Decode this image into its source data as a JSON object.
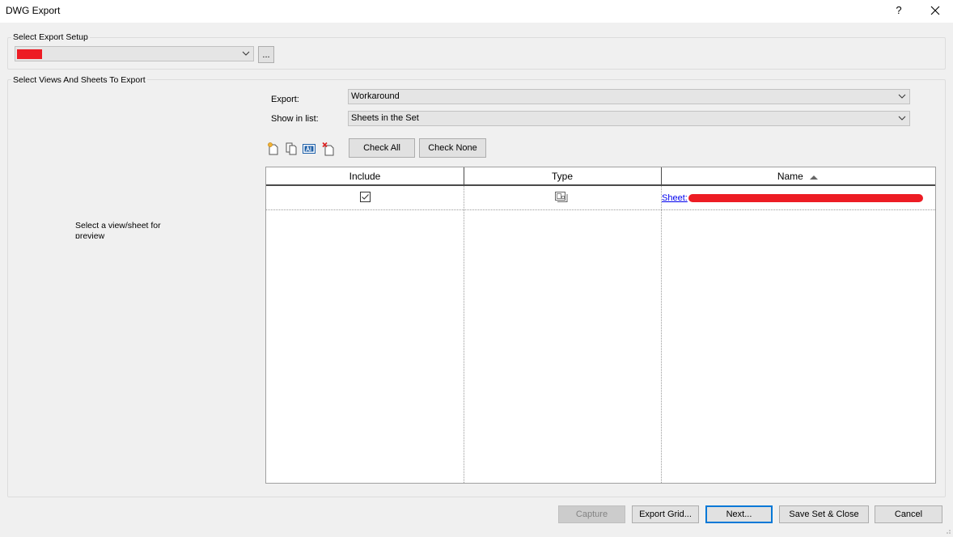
{
  "window": {
    "title": "DWG Export",
    "help": "?"
  },
  "export_setup": {
    "group_label": "Select Export Setup",
    "selected_value": "",
    "browse_label": "..."
  },
  "views_sheets": {
    "group_label": "Select Views And Sheets To Export",
    "preview_text": "Select a view/sheet for preview",
    "export_label": "Export:",
    "export_value": "Workaround",
    "show_label": "Show in list:",
    "show_value": "Sheets in the Set",
    "check_all_label": "Check All",
    "check_none_label": "Check None",
    "tool_icons": [
      "new-set-icon",
      "duplicate-set-icon",
      "rename-set-icon",
      "delete-set-icon"
    ]
  },
  "table": {
    "columns": [
      "Include",
      "Type",
      "Name"
    ],
    "sort_column": "Name",
    "rows": [
      {
        "include": true,
        "type_icon": "sheet-icon",
        "name": "Sheet: "
      }
    ]
  },
  "footer": {
    "capture_label": "Capture",
    "export_grid_label": "Export Grid...",
    "next_label": "Next...",
    "save_close_label": "Save Set & Close",
    "cancel_label": "Cancel"
  },
  "colors": {
    "redaction": "#ed1c24",
    "link": "#0000ee",
    "focus": "#0078d7"
  }
}
